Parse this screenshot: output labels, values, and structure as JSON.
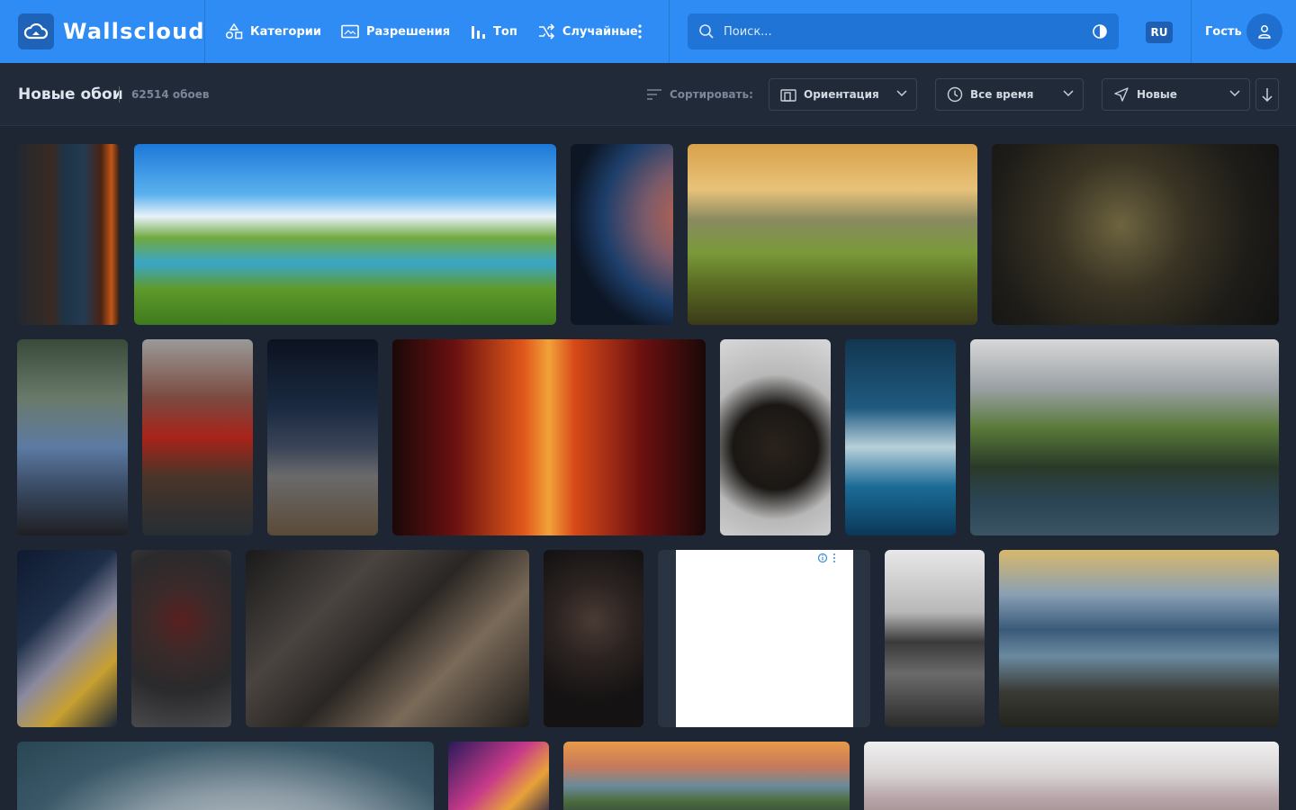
{
  "header": {
    "logo_text": "Wallscloud",
    "nav": [
      {
        "label": "Категории",
        "icon": "shapes-icon"
      },
      {
        "label": "Разрешения",
        "icon": "monitor-icon"
      },
      {
        "label": "Топ",
        "icon": "bar-chart-icon"
      },
      {
        "label": "Случайные",
        "icon": "shuffle-icon"
      }
    ],
    "search_placeholder": "Поиск...",
    "language": "RU",
    "guest_label": "Гость"
  },
  "toolbar": {
    "title": "Новые обои",
    "count": "62514 обоев",
    "sort_label": "Сортировать:",
    "orientation": "Ориентация",
    "period": "Все время",
    "order": "Новые"
  },
  "colors": {
    "header_bg": "#2f8cf4",
    "page_bg": "#1f2633",
    "toolbar_bg": "#212a38"
  },
  "gallery": {
    "rows": [
      [
        "burning-door",
        "fantasy-island-landscape",
        "astronaut-earth",
        "mountain-sunset-meadow",
        "dark-armored-knight"
      ],
      [
        "bunnies",
        "red-sailing-ship",
        "space-station-planet",
        "red-abstract-circuit",
        "doberman-sunglasses",
        "lighthouse-storm-waves",
        "sea-cliffs"
      ],
      [
        "moon-night-tree",
        "red-eyed-wolf",
        "hero-city-skyscrapers",
        "masked-face",
        "advertisement",
        "rock-fog-reflection",
        "rocky-coast-sunset"
      ],
      [
        "moon-planet-flag",
        "space-castle-nebula",
        "coastal-cliffs-sunset",
        "flower-field-blur"
      ]
    ]
  }
}
